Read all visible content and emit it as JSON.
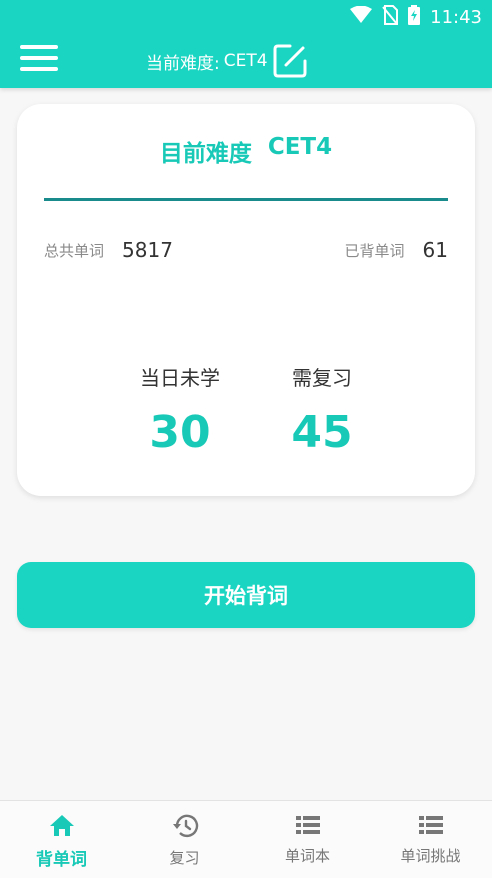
{
  "status_bar": {
    "time": "11:43",
    "icons": [
      "wifi-icon",
      "no-sim-icon",
      "battery-charging-icon"
    ]
  },
  "toolbar": {
    "title_label": "当前难度:",
    "title_value": "CET4",
    "menu_icon": "menu-icon",
    "edit_icon": "edit-icon"
  },
  "card": {
    "title_label": "目前难度",
    "title_value": "CET4",
    "total_words_label": "总共单词",
    "total_words_value": "5817",
    "learned_words_label": "已背单词",
    "learned_words_value": "61",
    "today_unlearned_label": "当日未学",
    "today_unlearned_value": "30",
    "need_review_label": "需复习",
    "need_review_value": "45"
  },
  "start_button": {
    "label": "开始背词"
  },
  "bottom_nav": {
    "items": [
      {
        "label": "背单词",
        "icon": "home-icon",
        "active": true
      },
      {
        "label": "复习",
        "icon": "history-icon",
        "active": false
      },
      {
        "label": "单词本",
        "icon": "list-icon",
        "active": false
      },
      {
        "label": "单词挑战",
        "icon": "list-icon",
        "active": false
      }
    ]
  },
  "colors": {
    "primary": "#19d5c2",
    "accent_text": "#19c9b7",
    "divider": "#1a8b8c",
    "background": "#f7f7f7"
  }
}
